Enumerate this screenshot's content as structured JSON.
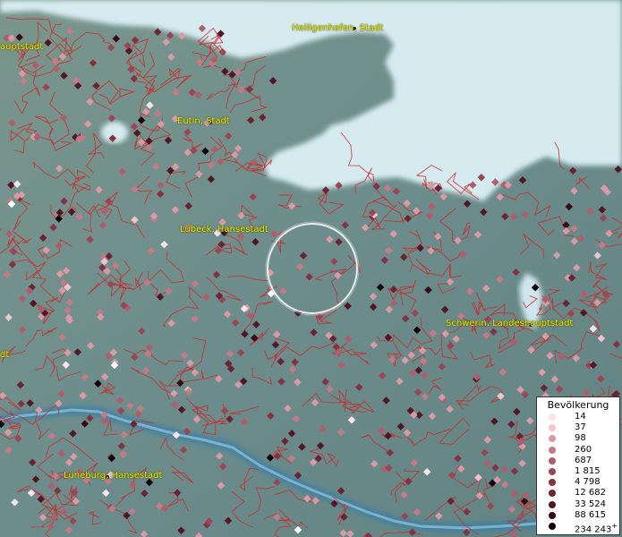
{
  "cities": [
    {
      "name": "Heiligenhafen, Stadt",
      "text": "Heiligenhafen, Stadt"
    },
    {
      "name": "Landeshauptstadt-left",
      "text": "auptstadt"
    },
    {
      "name": "Eutin",
      "text": "Eutin, Stadt"
    },
    {
      "name": "Luebeck",
      "text": "Lübeck, Hansestadt"
    },
    {
      "name": "Schwerin",
      "text": "Schwerin, Landeshauptstadt"
    },
    {
      "name": "Lueneburg",
      "text": "Lüneburg, Hansestadt"
    },
    {
      "name": "left-edge",
      "text": "dt"
    }
  ],
  "legend": {
    "title": "Bevölkerung",
    "entries": [
      {
        "label": "14",
        "color": "#fbe3ea"
      },
      {
        "label": "37",
        "color": "#f1c4cc"
      },
      {
        "label": "98",
        "color": "#d99aa5"
      },
      {
        "label": "260",
        "color": "#c47a87"
      },
      {
        "label": "687",
        "color": "#b05e6c"
      },
      {
        "label": "1 815",
        "color": "#9b4655"
      },
      {
        "label": "4 798",
        "color": "#843344"
      },
      {
        "label": "12 682",
        "color": "#6c2332"
      },
      {
        "label": "33 524",
        "color": "#521724"
      },
      {
        "label": "88 615",
        "color": "#360b15"
      },
      {
        "label": "234 243",
        "color": "#120206",
        "suffix": "+"
      }
    ]
  },
  "colors": {
    "land": "#6f8f8c",
    "sea": "#d6ebf0",
    "borders": "#cc2a2a",
    "river": "#3b7fa8",
    "label": "#e6e600"
  }
}
